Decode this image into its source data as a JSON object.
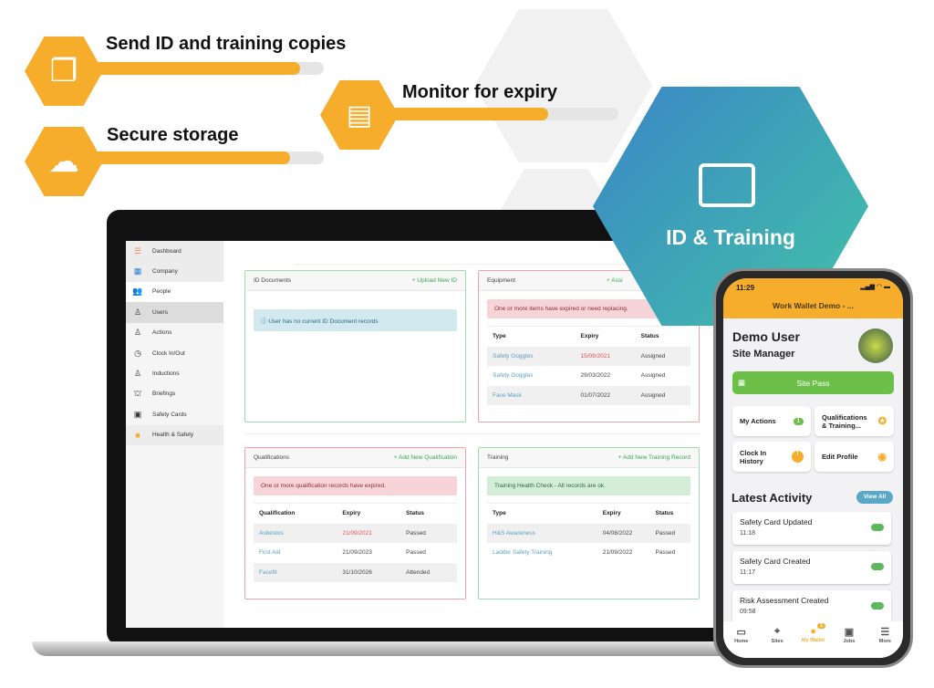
{
  "features": [
    {
      "title": "Send ID and training copies",
      "icon": "document-copy-icon",
      "progress": 0.9
    },
    {
      "title": "Monitor for expiry",
      "icon": "monitor-search-icon",
      "progress": 0.75
    },
    {
      "title": "Secure storage",
      "icon": "cloud-network-icon",
      "progress": 0.85
    }
  ],
  "hero": {
    "title": "ID & Training",
    "icon": "id-badge-icon"
  },
  "colors": {
    "accent": "#f6ad2c",
    "teal": "#3fa3b8",
    "green": "#6cc04a"
  },
  "sidebar": {
    "items": [
      {
        "label": "Dashboard",
        "icon": "dashboard-icon"
      },
      {
        "label": "Company",
        "icon": "building-icon"
      },
      {
        "label": "People",
        "icon": "people-icon"
      },
      {
        "label": "Users",
        "icon": "user-icon"
      },
      {
        "label": "Actions",
        "icon": "actions-icon"
      },
      {
        "label": "Clock In/Out",
        "icon": "clock-icon"
      },
      {
        "label": "Inductions",
        "icon": "inductions-icon"
      },
      {
        "label": "Briefings",
        "icon": "briefings-icon"
      },
      {
        "label": "Safety Cards",
        "icon": "safety-card-icon"
      },
      {
        "label": "Health & Safety",
        "icon": "hi-vis-vest-icon"
      }
    ]
  },
  "id_documents": {
    "title": "ID Documents",
    "action": "+ Upload New ID",
    "message": "User has no current ID Document records"
  },
  "equipment": {
    "title": "Equipment",
    "action": "+ Assi",
    "message": "One or more items have expired or need replacing.",
    "columns": [
      "Type",
      "Expiry",
      "Status"
    ],
    "rows": [
      [
        "Safety Goggles",
        "15/09/2021",
        "Assigned"
      ],
      [
        "Safety Goggles",
        "29/03/2022",
        "Assigned"
      ],
      [
        "Face Mask",
        "01/07/2022",
        "Assigned"
      ]
    ]
  },
  "qualifications": {
    "title": "Qualifications",
    "action": "+ Add New Qualification",
    "message": "One or more qualification records have expired.",
    "columns": [
      "Qualification",
      "Expiry",
      "Status"
    ],
    "rows": [
      [
        "Asbestos",
        "21/09/2021",
        "Passed"
      ],
      [
        "First Aid",
        "21/09/2023",
        "Passed"
      ],
      [
        "Facefit",
        "31/10/2026",
        "Attended"
      ]
    ]
  },
  "training": {
    "title": "Training",
    "action": "+ Add New Training Record",
    "message": "Training Health Check - All records are ok.",
    "columns": [
      "Type",
      "Expiry",
      "Status"
    ],
    "rows": [
      [
        "H&S Awareness",
        "04/08/2022",
        "Passed"
      ],
      [
        "Ladder Safety Training",
        "21/09/2022",
        "Passed"
      ]
    ]
  },
  "phone": {
    "time": "11:29",
    "header": "Work Wallet Demo - ...",
    "user_name": "Demo User",
    "user_role": "Site Manager",
    "site_pass": "Site Pass",
    "tiles": [
      {
        "label": "My Actions",
        "badge": "1"
      },
      {
        "label": "Qualifications & Training..."
      },
      {
        "label": "Clock In History"
      },
      {
        "label": "Edit Profile"
      }
    ],
    "latest_activity": "Latest Activity",
    "view_all": "View All",
    "activities": [
      {
        "title": "Safety Card Updated",
        "time": "11:18"
      },
      {
        "title": "Safety Card Created",
        "time": "11:17"
      },
      {
        "title": "Risk Assessment Created",
        "time": "09:58"
      }
    ],
    "tabs": [
      {
        "label": "Home",
        "icon": "home-icon"
      },
      {
        "label": "Sites",
        "icon": "location-pin-icon"
      },
      {
        "label": "My Wallet",
        "icon": "wallet-user-icon",
        "badge": "1"
      },
      {
        "label": "Jobs",
        "icon": "briefcase-icon"
      },
      {
        "label": "More",
        "icon": "list-icon"
      }
    ]
  }
}
